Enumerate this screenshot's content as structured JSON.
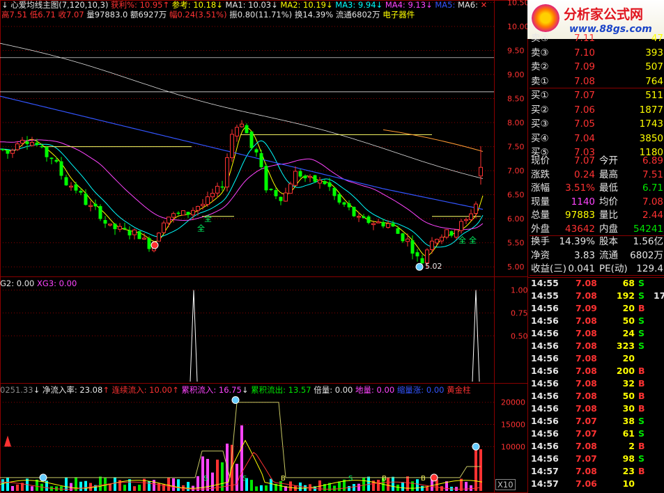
{
  "colors": {
    "up": "#ff3232",
    "down": "#00e6ff",
    "grid": "#8b0000",
    "bg": "#000000",
    "flat": "#e6e6e6"
  },
  "header": {
    "main_title": "心爱均线主图(7,120,10,3)",
    "profit_label": "获利%: 10.95",
    "ref_label": "参考: 10.18",
    "ma1": "MA1: 10.03",
    "ma2": "MA2: 10.19",
    "ma3": "MA3: 9.94",
    "ma4": "MA4: 9.13",
    "ma5": "MA5:",
    "ma6": "MA6:",
    "quote_high": "高7.51",
    "quote_low": "低6.71",
    "quote_close": "收7.07",
    "quote_vol": "量97883.0",
    "quote_amt": "额6927万",
    "quote_chg": "幅0.24(3.51%)",
    "quote_amp": "振0.80(11.71%)",
    "quote_turn": "换14.39%",
    "quote_float": "流通6802万",
    "quote_sector": "电子器件",
    "sub1": "G2: 0.00",
    "sub1b": "XG3: 0.00",
    "sub2_a": "0251.33",
    "sub2_b": "净流入率: 23.08",
    "sub2_c": "连续流入: 10.00",
    "sub2_d": "累积流入: 16.75",
    "sub2_e": "累积流出: 13.57",
    "sub2_f": "倍量: 0.00",
    "sub2_g": "地量: 0.00",
    "sub2_h": "缩量涨: 0.00",
    "sub2_i": "黄金柱",
    "x10": "X10"
  },
  "logo": {
    "brand": "分析家公式网",
    "url": "www.88gs.com"
  },
  "annotations": {
    "low_label": "5.02",
    "tag_quan": "全",
    "tag_s": "S",
    "tag_b": "B"
  },
  "order_book": [
    {
      "label": "卖④",
      "price": "7.11",
      "vol": "47"
    },
    {
      "label": "卖③",
      "price": "7.10",
      "vol": "393"
    },
    {
      "label": "卖②",
      "price": "7.09",
      "vol": "507"
    },
    {
      "label": "卖①",
      "price": "7.08",
      "vol": "764"
    },
    {
      "label": "买①",
      "price": "7.07",
      "vol": "511"
    },
    {
      "label": "买②",
      "price": "7.06",
      "vol": "1877"
    },
    {
      "label": "买③",
      "price": "7.05",
      "vol": "1743"
    },
    {
      "label": "买④",
      "price": "7.04",
      "vol": "3850"
    },
    {
      "label": "买⑤",
      "price": "7.03",
      "vol": "1180"
    }
  ],
  "stats": [
    {
      "l1": "现价",
      "v1": "7.07",
      "c1": "red",
      "l2": "今开",
      "v2": "6.89",
      "c2": "red"
    },
    {
      "l1": "涨跌",
      "v1": "0.24",
      "c1": "red",
      "l2": "最高",
      "v2": "7.51",
      "c2": "red"
    },
    {
      "l1": "涨幅",
      "v1": "3.51%",
      "c1": "red",
      "l2": "最低",
      "v2": "6.71",
      "c2": "grn"
    },
    {
      "l1": "现量",
      "v1": "1140",
      "c1": "mag",
      "l2": "均价",
      "v2": "7.08",
      "c2": "red"
    },
    {
      "l1": "总量",
      "v1": "97883",
      "c1": "yel",
      "l2": "量比",
      "v2": "2.44",
      "c2": "red"
    },
    {
      "l1": "外盘",
      "v1": "43642",
      "c1": "red",
      "l2": "内盘",
      "v2": "54241",
      "c2": "grn"
    }
  ],
  "fundamentals": [
    {
      "l1": "换手",
      "v1": "14.39%",
      "l2": "股本",
      "v2": "1.56亿"
    },
    {
      "l1": "净资",
      "v1": "3.83",
      "l2": "流通",
      "v2": "6802万"
    },
    {
      "l1": "收益(三)",
      "v1": "0.041",
      "l2": "PE(动)",
      "v2": "129.4"
    }
  ],
  "trades": [
    {
      "t": "14:55",
      "p": "7.08",
      "v": "68",
      "f": "S"
    },
    {
      "t": "14:55",
      "p": "7.08",
      "v": "192",
      "f": "S",
      "x": "17"
    },
    {
      "t": "14:56",
      "p": "7.09",
      "v": "20",
      "f": "B"
    },
    {
      "t": "14:56",
      "p": "7.08",
      "v": "50",
      "f": "S"
    },
    {
      "t": "14:56",
      "p": "7.08",
      "v": "24",
      "f": "S"
    },
    {
      "t": "14:56",
      "p": "7.08",
      "v": "323",
      "f": "S"
    },
    {
      "t": "14:56",
      "p": "7.08",
      "v": "20",
      "f": ""
    },
    {
      "t": "14:56",
      "p": "7.08",
      "v": "200",
      "f": "B"
    },
    {
      "t": "14:56",
      "p": "7.08",
      "v": "32",
      "f": "B"
    },
    {
      "t": "14:56",
      "p": "7.08",
      "v": "50",
      "f": "B"
    },
    {
      "t": "14:56",
      "p": "7.08",
      "v": "30",
      "f": "B"
    },
    {
      "t": "14:56",
      "p": "7.07",
      "v": "38",
      "f": "S"
    },
    {
      "t": "14:56",
      "p": "7.07",
      "v": "61",
      "f": "S"
    },
    {
      "t": "14:56",
      "p": "7.08",
      "v": "2",
      "f": "B"
    },
    {
      "t": "14:56",
      "p": "7.07",
      "v": "98",
      "f": "S"
    },
    {
      "t": "14:57",
      "p": "7.08",
      "v": "23",
      "f": "B"
    },
    {
      "t": "14:57",
      "p": "7.06",
      "v": "10",
      "f": ""
    }
  ],
  "chart_data": [
    {
      "type": "candlestick",
      "yticks": [
        "10.50",
        "10.00",
        "9.50",
        "9.00",
        "8.50",
        "8.00",
        "7.50",
        "7.00",
        "6.50",
        "6.00",
        "5.50",
        "5.00"
      ],
      "ylim": [
        4.8,
        10.55
      ],
      "grid": true,
      "price_low_marker": 5.02,
      "last": {
        "open": 6.89,
        "high": 7.51,
        "low": 6.71,
        "close": 7.07
      }
    },
    {
      "type": "line",
      "yticks": [
        "1.00",
        "0.75",
        "0.50"
      ],
      "ylim": [
        0,
        1.05
      ],
      "spike_values": [
        1.0,
        1.0
      ]
    },
    {
      "type": "bar",
      "yticks": [
        "20000",
        "15000",
        "10000"
      ],
      "ylim": [
        0,
        22000
      ]
    }
  ]
}
